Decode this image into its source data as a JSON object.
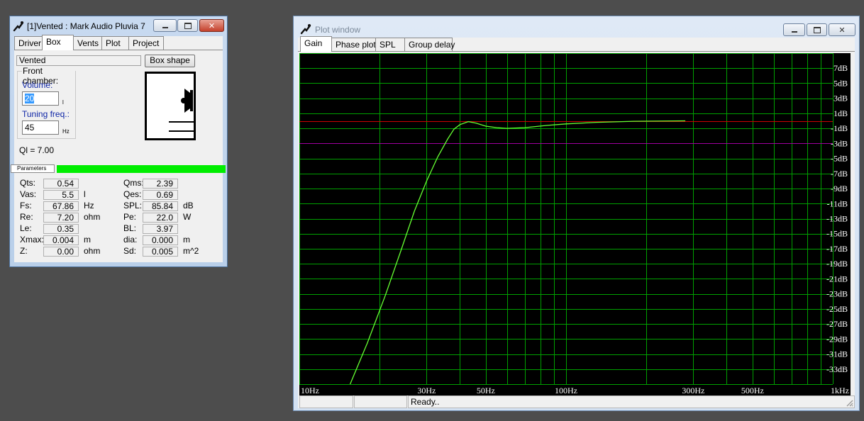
{
  "box_window": {
    "title": "[1]Vented : Mark Audio Pluvia 7",
    "tabs": [
      "Driver",
      "Box",
      "Vents",
      "Plot",
      "Project"
    ],
    "box_type_value": "Vented",
    "box_shape_label": "Box shape",
    "front_chamber_label": "Front chamber:",
    "volume_label": "Volume:",
    "volume_value": "20",
    "volume_unit": "l",
    "tuning_label": "Tuning freq.:",
    "tuning_value": "45",
    "tuning_unit": "Hz",
    "ql_text": "Ql = 7.00",
    "parameters_tab": "Parameters",
    "params": [
      {
        "label": "Qts:",
        "value": "0.54",
        "unit": "",
        "label2": "Qms:",
        "value2": "2.39",
        "unit2": ""
      },
      {
        "label": "Vas:",
        "value": "5.5",
        "unit": "l",
        "label2": "Qes:",
        "value2": "0.69",
        "unit2": ""
      },
      {
        "label": "Fs:",
        "value": "67.86",
        "unit": "Hz",
        "label2": "SPL:",
        "value2": "85.84",
        "unit2": "dB"
      },
      {
        "label": "Re:",
        "value": "7.20",
        "unit": "ohm",
        "label2": "Pe:",
        "value2": "22.0",
        "unit2": "W"
      },
      {
        "label": "Le:",
        "value": "0.35",
        "unit": "",
        "label2": "BL:",
        "value2": "3.97",
        "unit2": ""
      },
      {
        "label": "Xmax:",
        "value": "0.004",
        "unit": "m",
        "label2": "dia:",
        "value2": "0.000",
        "unit2": "m"
      },
      {
        "label": "Z:",
        "value": "0.00",
        "unit": "ohm",
        "label2": "Sd:",
        "value2": "0.005",
        "unit2": "m^2"
      }
    ]
  },
  "plot_window": {
    "title": "Plot window",
    "tabs": [
      "Gain",
      "Phase plot",
      "SPL",
      "Group delay"
    ],
    "status_text": "Ready.."
  },
  "colors": {
    "grid": "#00a000",
    "curve": "#66ff33",
    "reference_0db": "#cc0000",
    "reference_minus3db": "#a000a0",
    "param_bar": "#00ee00"
  },
  "chart_data": {
    "type": "line",
    "x_scale": "log",
    "xlim": [
      10,
      1000
    ],
    "ylim": [
      -35,
      9
    ],
    "x_tick_labels": [
      {
        "value": 10,
        "label": "10Hz"
      },
      {
        "value": 30,
        "label": "30Hz"
      },
      {
        "value": 50,
        "label": "50Hz"
      },
      {
        "value": 100,
        "label": "100Hz"
      },
      {
        "value": 300,
        "label": "300Hz"
      },
      {
        "value": 500,
        "label": "500Hz"
      },
      {
        "value": 1000,
        "label": "1kHz"
      }
    ],
    "y_tick_labels": [
      {
        "value": 7,
        "label": "7dB"
      },
      {
        "value": 5,
        "label": "5dB"
      },
      {
        "value": 3,
        "label": "3dB"
      },
      {
        "value": 1,
        "label": "1dB"
      },
      {
        "value": -1,
        "label": "-1dB"
      },
      {
        "value": -3,
        "label": "-3dB"
      },
      {
        "value": -5,
        "label": "-5dB"
      },
      {
        "value": -7,
        "label": "-7dB"
      },
      {
        "value": -9,
        "label": "-9dB"
      },
      {
        "value": -11,
        "label": "-11dB"
      },
      {
        "value": -13,
        "label": "-13dB"
      },
      {
        "value": -15,
        "label": "-15dB"
      },
      {
        "value": -17,
        "label": "-17dB"
      },
      {
        "value": -19,
        "label": "-19dB"
      },
      {
        "value": -21,
        "label": "-21dB"
      },
      {
        "value": -23,
        "label": "-23dB"
      },
      {
        "value": -25,
        "label": "-25dB"
      },
      {
        "value": -27,
        "label": "-27dB"
      },
      {
        "value": -29,
        "label": "-29dB"
      },
      {
        "value": -31,
        "label": "-31dB"
      },
      {
        "value": -33,
        "label": "-33dB"
      }
    ],
    "reference_lines": [
      {
        "y": 0,
        "color": "#cc0000"
      },
      {
        "y": -3,
        "color": "#a000a0"
      }
    ],
    "series": [
      {
        "color": "#66ff33",
        "points": [
          [
            15.5,
            -35
          ],
          [
            18,
            -29.5
          ],
          [
            21,
            -23.2
          ],
          [
            24,
            -17.3
          ],
          [
            27,
            -12.0
          ],
          [
            30,
            -8.0
          ],
          [
            33,
            -4.8
          ],
          [
            36,
            -2.4
          ],
          [
            38,
            -1.1
          ],
          [
            40,
            -0.5
          ],
          [
            43,
            -0.1
          ],
          [
            46,
            -0.3
          ],
          [
            50,
            -0.7
          ],
          [
            55,
            -0.9
          ],
          [
            60,
            -1.0
          ],
          [
            70,
            -0.9
          ],
          [
            85,
            -0.6
          ],
          [
            100,
            -0.4
          ],
          [
            130,
            -0.2
          ],
          [
            180,
            -0.05
          ],
          [
            280,
            0
          ]
        ]
      }
    ]
  }
}
